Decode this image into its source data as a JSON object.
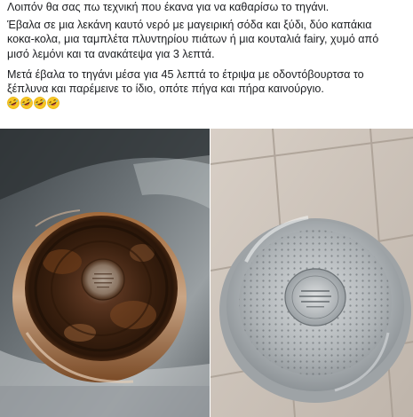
{
  "post": {
    "lines_para1": [
      "Λοιπόν θα σας πω τεχνική που έκανα για να καθαρίσω το τηγάνι."
    ],
    "lines_para2": [
      "Έβαλα σε μια λεκάνη καυτό νερό με μαγειρική σόδα και ξύδι, δύο καπάκια",
      "κοκα-κολα, μια ταμπλέτα πλυντηρίου πιάτων ή μια κουταλιά fairy, χυμό από",
      "μισό λεμόνι και τα ανακάτεψα για 3 λεπτά."
    ],
    "lines_para3": [
      "Μετά έβαλα το τηγάνι μέσα για 45 λεπτά το έτριψα με οδοντόβουρτσα το",
      "ξέπλυνα και παρέμεινε το ίδιο, οπότε πήγα και πήρα καινούργιο."
    ],
    "emojis": [
      "rolling-on-floor-laughing",
      "rolling-on-floor-laughing",
      "rolling-on-floor-laughing",
      "rolling-on-floor-laughing"
    ]
  },
  "photos": {
    "before": "burnt-pan-bottom-in-sink",
    "after": "clean-pan-bottom-on-tiles"
  },
  "colors": {
    "text": "#1c1e21",
    "rust": "#6b3418",
    "steel": "#b8bcbf",
    "tile": "#cfc6bd"
  }
}
